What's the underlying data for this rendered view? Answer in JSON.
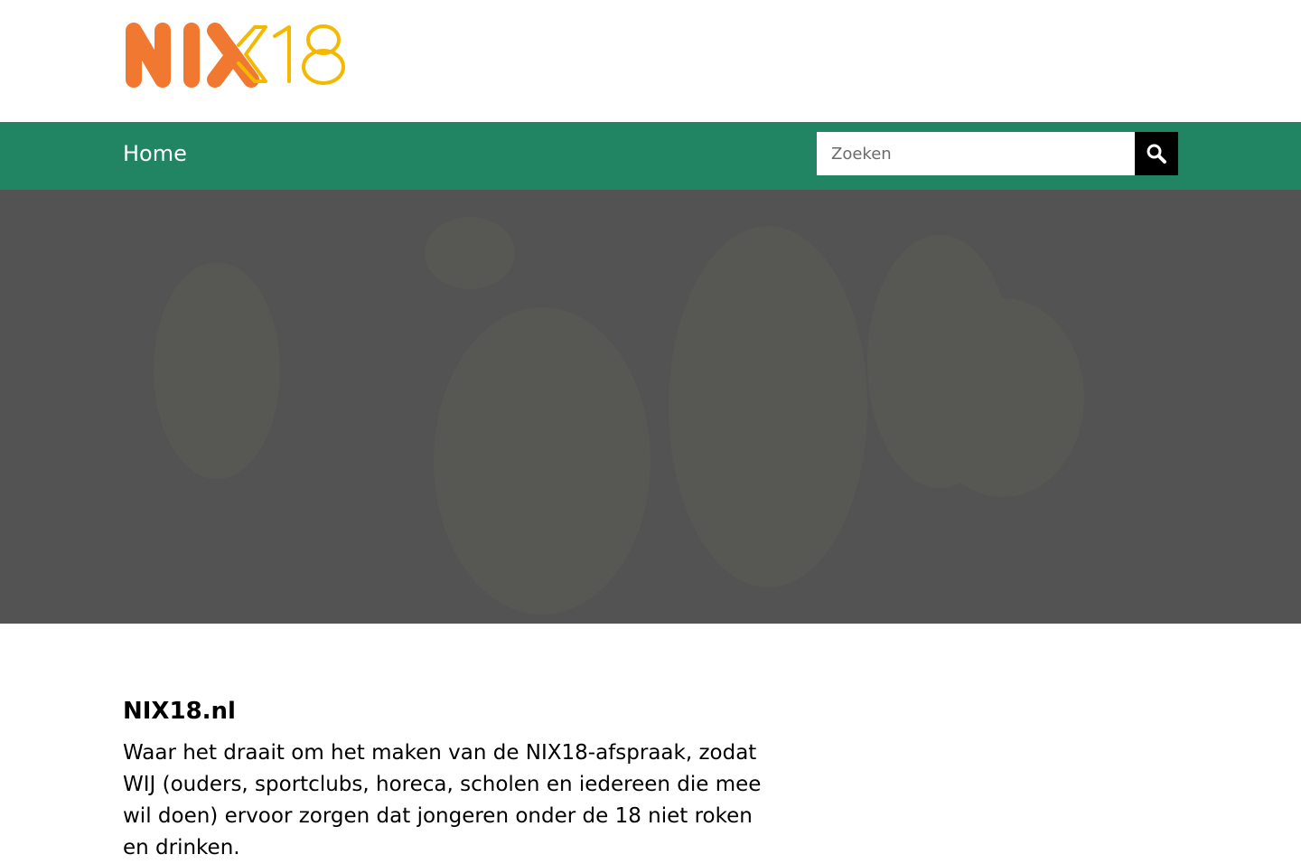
{
  "brand": {
    "logo_text_left": "NIX",
    "logo_text_right": "18",
    "orange": "#f07830",
    "yellow": "#f5b800"
  },
  "nav": {
    "home_label": "Home",
    "background": "#218462"
  },
  "search": {
    "placeholder": "Zoeken",
    "icon": "search-icon"
  },
  "hero": {
    "background": "#535353"
  },
  "main": {
    "title": "NIX18.nl",
    "intro": "Waar het draait om het maken van de NIX18-afspraak, zodat WIJ (ouders, sportclubs, horeca, scholen en iedereen die mee wil doen) ervoor zorgen dat jongeren onder de 18 niet roken en drinken."
  }
}
